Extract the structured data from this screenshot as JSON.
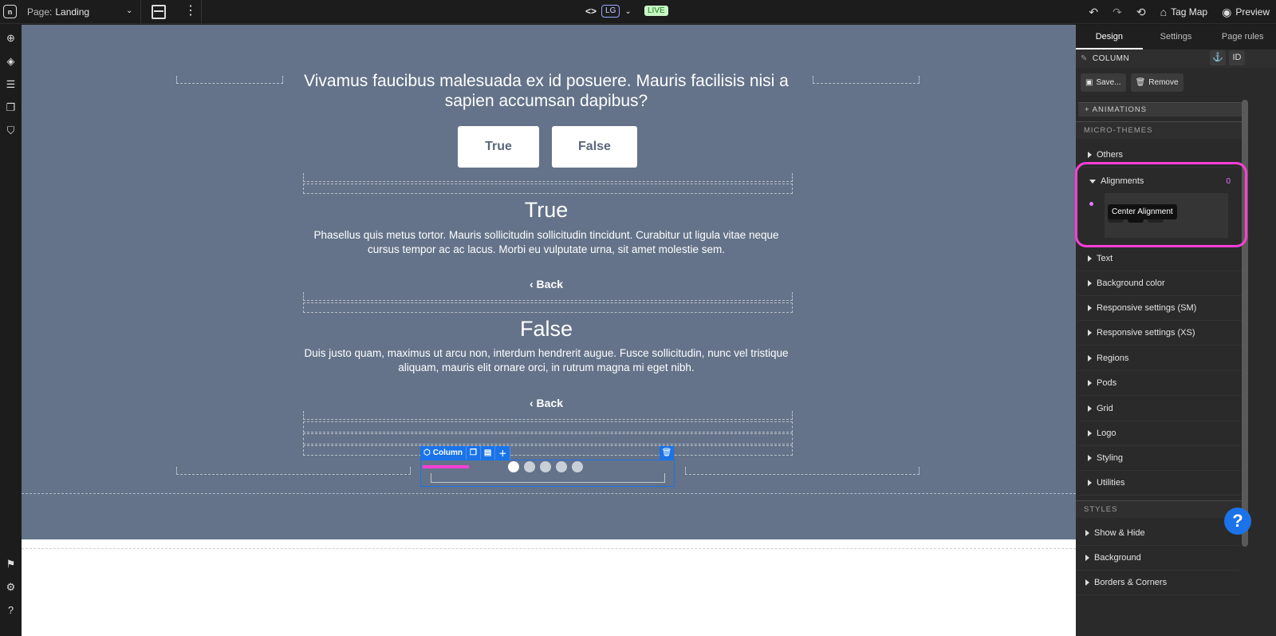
{
  "topbar": {
    "page_label": "Page:",
    "page_name": "Landing",
    "code_icon": "<>",
    "breakpoint": "LG",
    "live_badge": "LIVE",
    "tag_map": "Tag Map",
    "preview": "Preview"
  },
  "canvas": {
    "question": "Vivamus faucibus malesuada ex id posuere. Mauris facilisis nisi a sapien accumsan dapibus?",
    "true_button": "True",
    "false_button": "False",
    "result_true": {
      "title": "True",
      "body": "Phasellus quis metus tortor. Mauris sollicitudin sollicitudin tincidunt. Curabitur ut ligula vitae neque cursus tempor ac ac lacus. Morbi eu vulputate urna, sit amet molestie sem.",
      "back": "Back"
    },
    "result_false": {
      "title": "False",
      "body": "Duis justo quam, maximus ut arcu non, interdum hendrerit augue. Fusce sollicitudin, nunc vel tristique aliquam, mauris elit ornare orci, in rutrum magna mi eget nibh.",
      "back": "Back"
    },
    "column_toolbar_label": "Column",
    "carousel_dots": 5,
    "active_dot": 1
  },
  "panel": {
    "tabs": [
      "Design",
      "Settings",
      "Page rules"
    ],
    "active_tab": "Design",
    "element_type": "COLUMN",
    "id_button": "ID",
    "save_button": "Save...",
    "remove_button": "Remove",
    "animations_label": "+ ANIMATIONS",
    "micro_themes_label": "MICRO-THEMES",
    "others_label": "Others",
    "alignments_label": "Alignments",
    "alignments_count": "0",
    "tooltip": "Center Alignment",
    "micro_theme_items": [
      "Text",
      "Background color",
      "Responsive settings (SM)",
      "Responsive settings (XS)",
      "Regions",
      "Pods",
      "Grid",
      "Logo",
      "Styling",
      "Utilities"
    ],
    "styles_label": "STYLES",
    "style_items": [
      "Show & Hide",
      "Background",
      "Borders & Corners"
    ]
  },
  "colors": {
    "hero_bg": "#647389",
    "accent_blue": "#1a73e8",
    "highlight_pink": "#ff3fd6",
    "panel_bg": "#2a2a2a"
  }
}
